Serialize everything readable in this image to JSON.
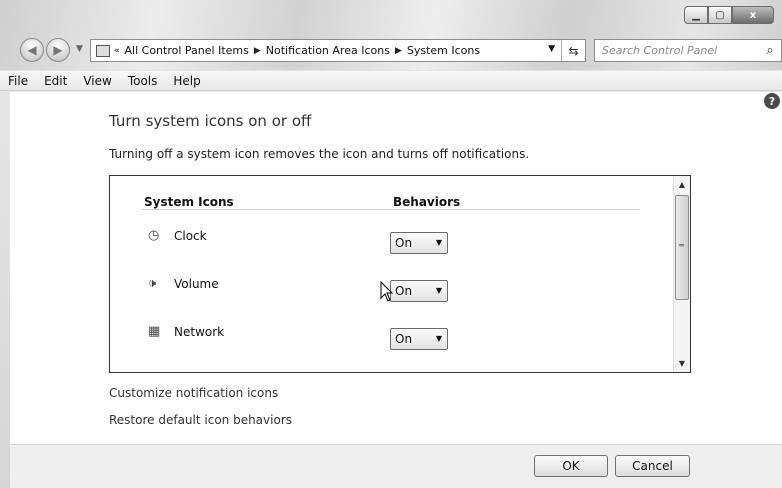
{
  "window": {
    "minimize_icon": "minimize-icon",
    "maximize_icon": "maximize-icon",
    "close_label": "x"
  },
  "nav": {
    "back_icon": "back-arrow-icon",
    "forward_icon": "forward-arrow-icon",
    "breadcrumb": [
      "All Control Panel Items",
      "Notification Area Icons",
      "System Icons"
    ],
    "breadcrumb_prefix": "«",
    "search_placeholder": "Search Control Panel"
  },
  "menubar": {
    "items": [
      "File",
      "Edit",
      "View",
      "Tools",
      "Help"
    ]
  },
  "content": {
    "help_label": "?",
    "heading": "Turn system icons on or off",
    "description": "Turning off a system icon removes the icon and turns off notifications.",
    "table": {
      "headers": [
        "System Icons",
        "Behaviors"
      ],
      "rows": [
        {
          "icon": "clock-icon",
          "label": "Clock",
          "behavior": "On"
        },
        {
          "icon": "volume-icon",
          "label": "Volume",
          "behavior": "On"
        },
        {
          "icon": "network-icon",
          "label": "Network",
          "behavior": "On"
        }
      ]
    },
    "links": {
      "customize": "Customize notification icons",
      "restore": "Restore default icon behaviors"
    }
  },
  "footer": {
    "ok_label": "OK",
    "cancel_label": "Cancel"
  }
}
